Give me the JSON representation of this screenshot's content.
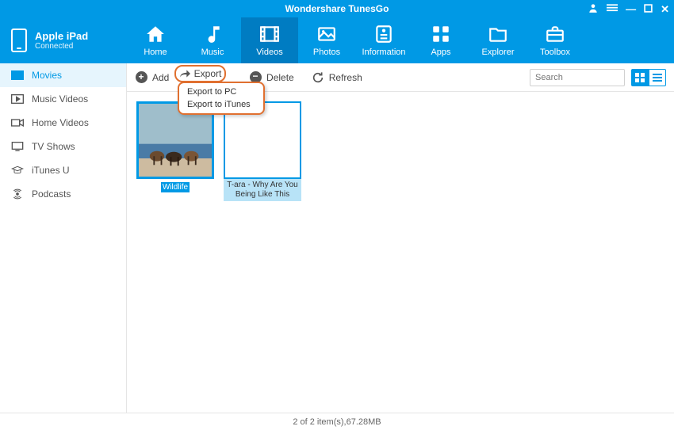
{
  "app_title": "Wondershare TunesGo",
  "device": {
    "name": "Apple iPad",
    "status": "Connected"
  },
  "tabs": {
    "home": "Home",
    "music": "Music",
    "videos": "Videos",
    "photos": "Photos",
    "information": "Information",
    "apps": "Apps",
    "explorer": "Explorer",
    "toolbox": "Toolbox"
  },
  "sidebar": {
    "movies": "Movies",
    "music_videos": "Music Videos",
    "home_videos": "Home Videos",
    "tv_shows": "TV Shows",
    "itunes_u": "iTunes U",
    "podcasts": "Podcasts"
  },
  "toolbar": {
    "add": "Add",
    "export": "Export",
    "delete": "Delete",
    "refresh": "Refresh",
    "search_placeholder": "Search"
  },
  "export_menu": {
    "to_pc": "Export to PC",
    "to_itunes": "Export to iTunes"
  },
  "items": {
    "wildlife": "Wildlife",
    "tara": "T-ara - Why Are You Being Like This"
  },
  "status": "2 of 2 item(s),67.28MB"
}
